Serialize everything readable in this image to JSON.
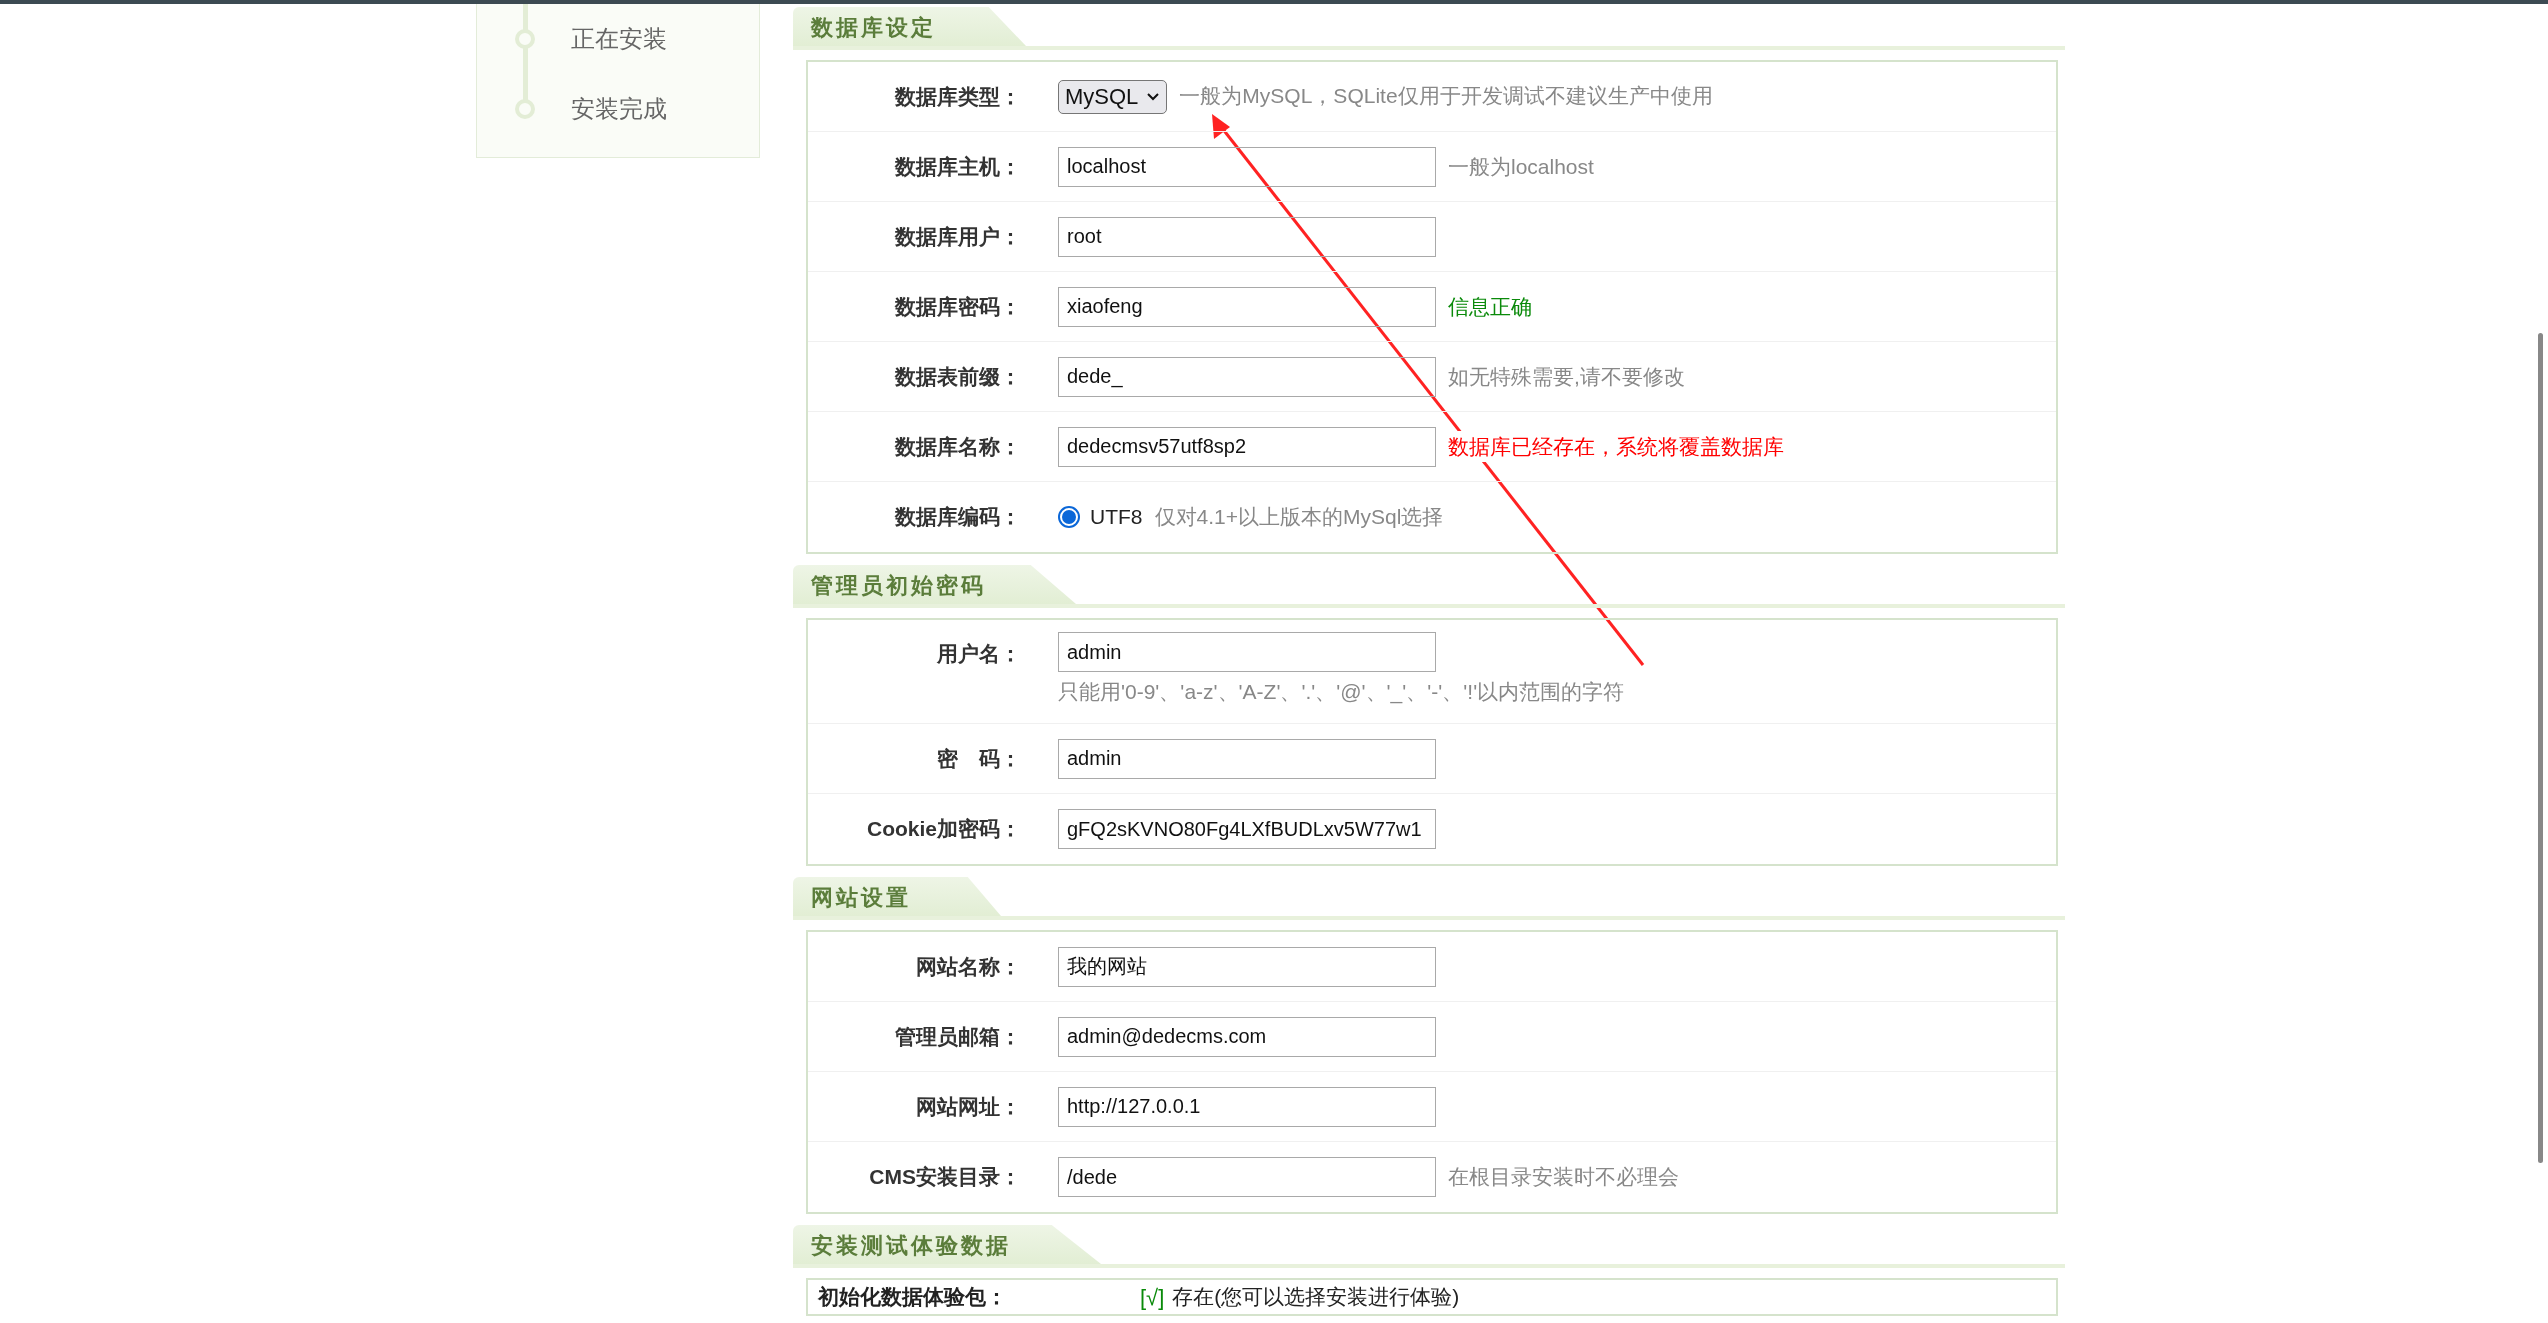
{
  "sidebar": {
    "steps": [
      {
        "label": "正在安装"
      },
      {
        "label": "安装完成"
      }
    ]
  },
  "sections": [
    {
      "title": "数据库设定",
      "rows": [
        {
          "kind": "select",
          "label": "数据库类型：",
          "value": "MySQL",
          "hint": "一般为MySQL，SQLite仅用于开发调试不建议生产中使用",
          "color": "#888888"
        },
        {
          "kind": "input",
          "label": "数据库主机：",
          "value": "localhost",
          "hint": "一般为localhost",
          "color": "#888888"
        },
        {
          "kind": "input",
          "label": "数据库用户：",
          "value": "root"
        },
        {
          "kind": "input",
          "label": "数据库密码：",
          "value": "xiaofeng",
          "hint": "信息正确",
          "color": "#0a8a0a"
        },
        {
          "kind": "input",
          "label": "数据表前缀：",
          "value": "dede_",
          "hint": "如无特殊需要,请不要修改",
          "color": "#888888"
        },
        {
          "kind": "input",
          "label": "数据库名称：",
          "value": "dedecmsv57utf8sp2",
          "hint": "数据库已经存在，系统将覆盖数据库",
          "color": "#ff0000"
        },
        {
          "kind": "radio",
          "label": "数据库编码：",
          "checked": true,
          "value": "UTF8",
          "hint": "仅对4.1+以上版本的MySql选择",
          "color": "#888888"
        }
      ]
    },
    {
      "title": "管理员初始密码",
      "rows": [
        {
          "kind": "input_note",
          "label": "用户名：",
          "value": "admin",
          "hint": "只能用'0-9'、'a-z'、'A-Z'、'.'、'@'、'_'、'-'、'!'以内范围的字符",
          "color": "#888888"
        },
        {
          "kind": "input",
          "label": "密　码：",
          "value": "admin"
        },
        {
          "kind": "input",
          "label": "Cookie加密码：",
          "value": "gFQ2sKVNO80Fg4LXfBUDLxv5W77w1"
        }
      ]
    },
    {
      "title": "网站设置",
      "rows": [
        {
          "kind": "input",
          "label": "网站名称：",
          "value": "我的网站"
        },
        {
          "kind": "input",
          "label": "管理员邮箱：",
          "value": "admin@dedecms.com"
        },
        {
          "kind": "input",
          "label": "网站网址：",
          "value": "http://127.0.0.1"
        },
        {
          "kind": "input",
          "label": "CMS安装目录：",
          "value": "/dede",
          "hint": "在根目录安装时不必理会",
          "color": "#888888"
        }
      ]
    },
    {
      "title": "安装测试体验数据",
      "rows": [
        {
          "kind": "status",
          "label": "初始化数据体验包：",
          "mark": "[√]",
          "value": "存在(您可以选择安装进行体验)"
        }
      ]
    }
  ]
}
